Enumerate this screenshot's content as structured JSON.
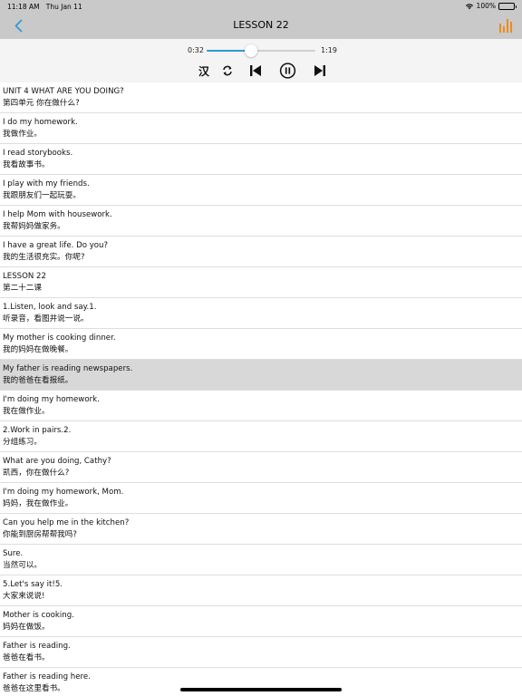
{
  "status_bar": {
    "time": "11:18 AM",
    "date": "Thu Jan 11",
    "battery": "100%"
  },
  "nav": {
    "title": "LESSON 22",
    "back_icon": "chevron-left-icon",
    "list_icon": "bar-list-icon",
    "accent": "#2b9bd6",
    "list_icon_color": "#f08a1c"
  },
  "player": {
    "elapsed": "0:32",
    "duration": "1:19",
    "progress_fraction": 0.405,
    "lang_label": "汉",
    "controls": [
      "translation-toggle",
      "loop-icon",
      "previous-icon",
      "pause-icon",
      "next-icon"
    ]
  },
  "sentences": [
    {
      "en": "UNIT 4 WHAT ARE YOU DOING?",
      "zh": "第四单元 你在做什么?"
    },
    {
      "en": "I do my homework.",
      "zh": "我做作业。"
    },
    {
      "en": "I read storybooks.",
      "zh": "我看故事书。"
    },
    {
      "en": "I play with my friends.",
      "zh": "我跟朋友们一起玩耍。"
    },
    {
      "en": "I help Mom with housework.",
      "zh": "我帮妈妈做家务。"
    },
    {
      "en": "I have a great life. Do you?",
      "zh": "我的生活很充实。你呢?"
    },
    {
      "en": "LESSON 22",
      "zh": "第二十二课"
    },
    {
      "en": "1.Listen, look and say.1.",
      "zh": "听录音，看图并说一说。"
    },
    {
      "en": "My mother is cooking dinner.",
      "zh": "我的妈妈在做晚餐。"
    },
    {
      "en": "My father is reading newspapers.",
      "zh": "我的爸爸在看报纸。",
      "selected": true
    },
    {
      "en": "I'm doing my homework.",
      "zh": "我在做作业。"
    },
    {
      "en": "2.Work in pairs.2.",
      "zh": "分组练习。"
    },
    {
      "en": "What are you doing, Cathy?",
      "zh": "凯西，你在做什么?"
    },
    {
      "en": "I'm doing my homework, Mom.",
      "zh": "妈妈，我在做作业。"
    },
    {
      "en": "Can you help me in the kitchen?",
      "zh": "你能到厨房帮帮我吗?"
    },
    {
      "en": "Sure.",
      "zh": "当然可以。"
    },
    {
      "en": "5.Let's say it!5.",
      "zh": "大家来说说!"
    },
    {
      "en": "Mother is cooking.",
      "zh": "妈妈在做饭。"
    },
    {
      "en": "Father is reading.",
      "zh": "爸爸在看书。"
    },
    {
      "en": "Father is reading here.",
      "zh": "爸爸在这里看书。"
    }
  ]
}
